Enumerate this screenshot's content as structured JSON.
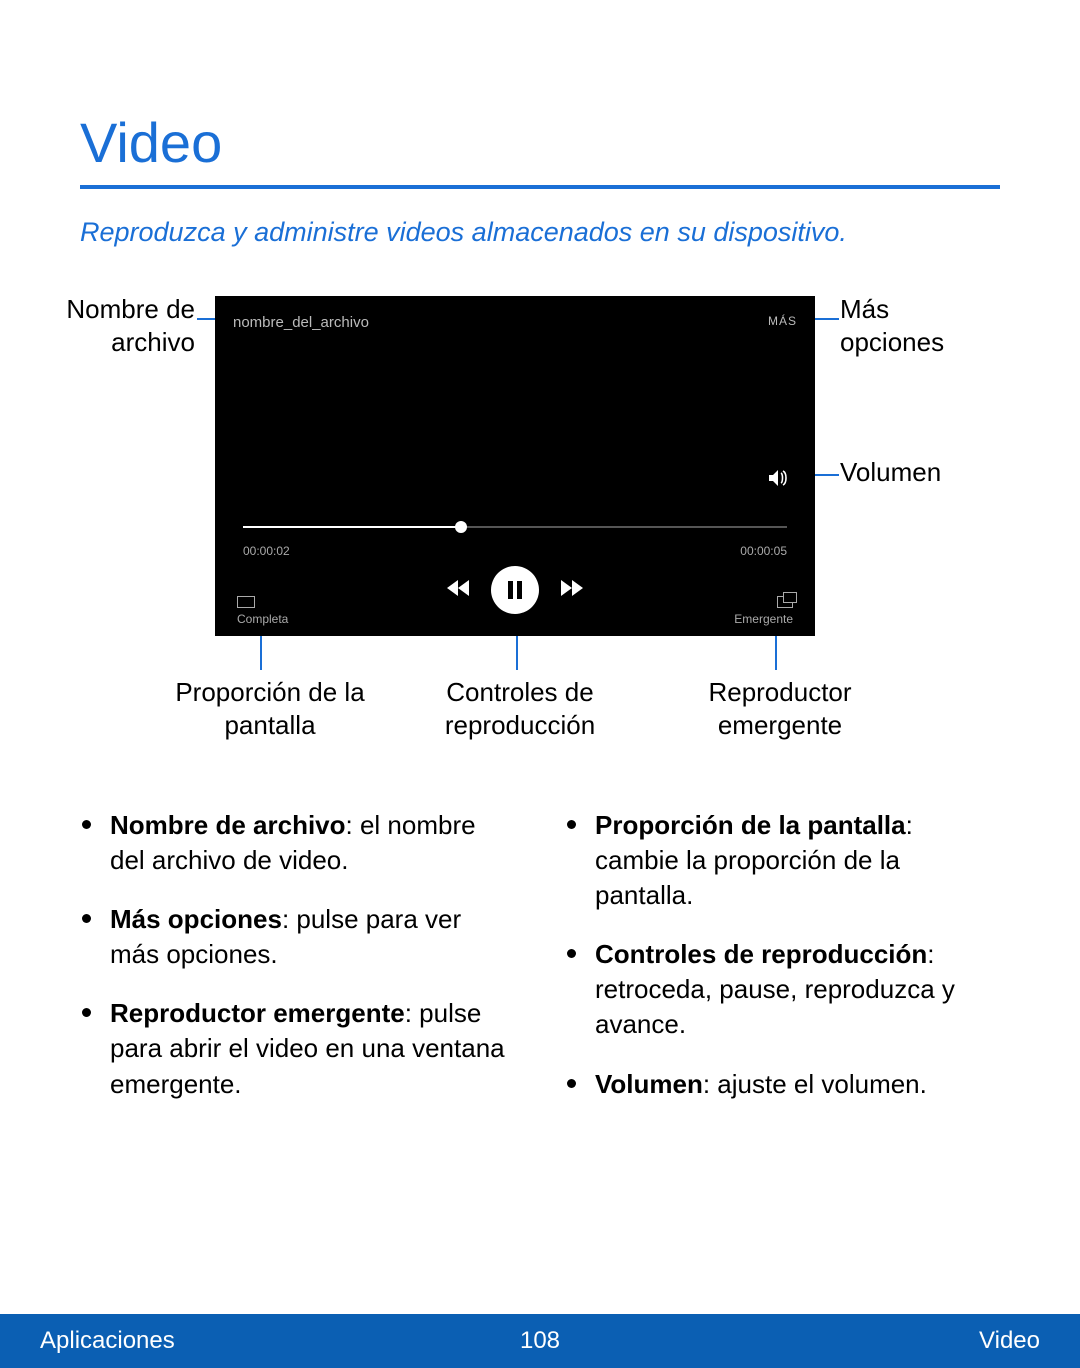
{
  "title": "Video",
  "subtitle": "Reproduzca y administre videos almacenados en su dispositivo.",
  "player": {
    "filename": "nombre_del_archivo",
    "more": "MÁS",
    "time_elapsed": "00:00:02",
    "time_total": "00:00:05",
    "ratio_label": "Completa",
    "popup_label": "Emergente"
  },
  "callouts": {
    "filename": "Nombre de archivo",
    "more": "Más opciones",
    "volume": "Volumen",
    "ratio": "Proporción de la pantalla",
    "controls": "Controles de reproducción",
    "popup": "Reproductor emergente"
  },
  "bullets_left": [
    {
      "term": "Nombre de archivo",
      "desc": ": el nombre del archivo de video."
    },
    {
      "term": "Más opciones",
      "desc": ": pulse para ver más opciones."
    },
    {
      "term": "Reproductor emergente",
      "desc": ": pulse para abrir el video en una ventana emergente."
    }
  ],
  "bullets_right": [
    {
      "term": "Proporción de la pantalla",
      "desc": ": cambie la proporción de la pantalla."
    },
    {
      "term": "Controles de reproducción",
      "desc": ": retroceda, pause, reproduzca y avance."
    },
    {
      "term": "Volumen",
      "desc": ": ajuste el volumen."
    }
  ],
  "footer": {
    "left": "Aplicaciones",
    "center": "108",
    "right": "Video"
  }
}
